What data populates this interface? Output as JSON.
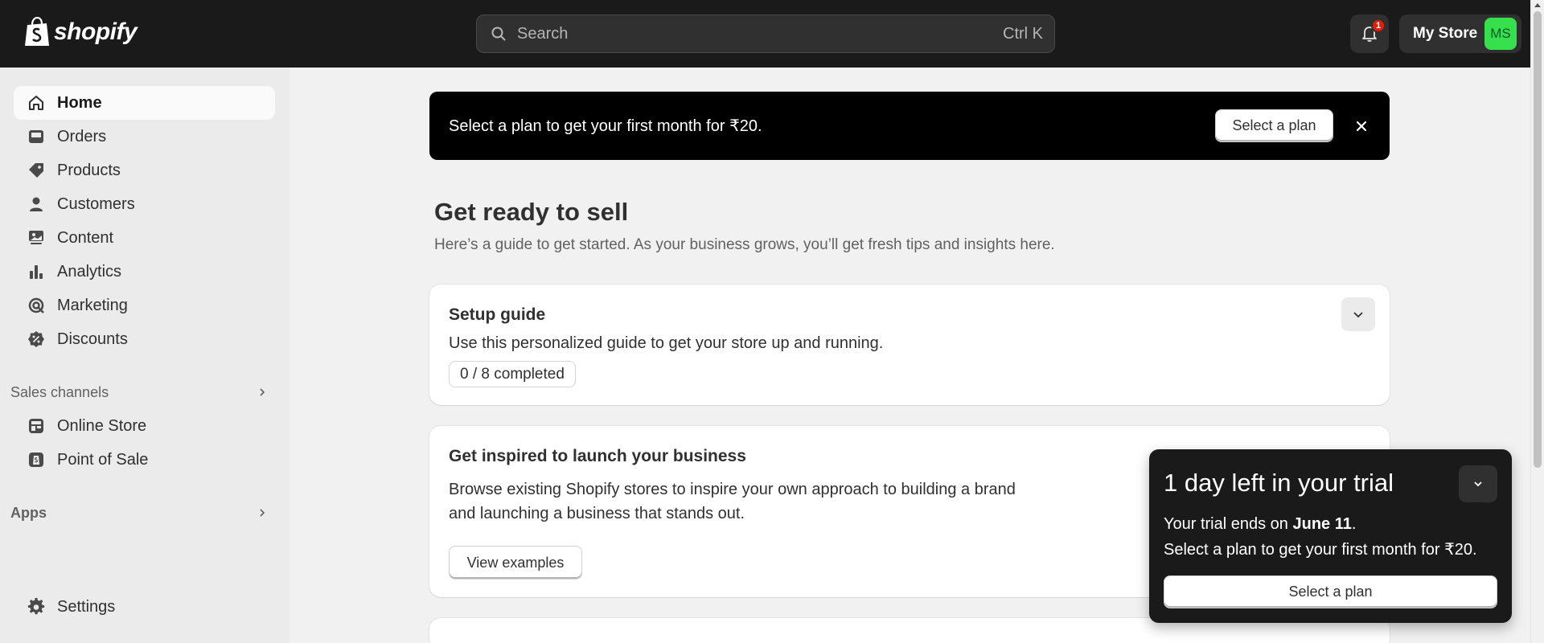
{
  "topbar": {
    "logo_text": "shopify",
    "search_placeholder": "Search",
    "search_shortcut": "Ctrl K",
    "notification_count": "1",
    "store_name": "My Store",
    "avatar_initials": "MS"
  },
  "sidebar": {
    "items": [
      {
        "label": "Home",
        "icon": "home-icon",
        "active": true
      },
      {
        "label": "Orders",
        "icon": "inbox-icon"
      },
      {
        "label": "Products",
        "icon": "tag-icon"
      },
      {
        "label": "Customers",
        "icon": "person-icon"
      },
      {
        "label": "Content",
        "icon": "content-icon"
      },
      {
        "label": "Analytics",
        "icon": "bar-chart-icon"
      },
      {
        "label": "Marketing",
        "icon": "target-icon"
      },
      {
        "label": "Discounts",
        "icon": "discount-icon"
      }
    ],
    "sales_channels_label": "Sales channels",
    "channels": [
      {
        "label": "Online Store",
        "icon": "store-icon"
      },
      {
        "label": "Point of Sale",
        "icon": "pos-icon"
      }
    ],
    "apps_label": "Apps",
    "settings_label": "Settings"
  },
  "banner": {
    "text": "Select a plan to get your first month for ₹20.",
    "button": "Select a plan"
  },
  "main": {
    "title": "Get ready to sell",
    "subtitle": "Here’s a guide to get started. As your business grows, you’ll get fresh tips and insights here.",
    "setup_card": {
      "title": "Setup guide",
      "text": "Use this personalized guide to get your store up and running.",
      "progress": "0 / 8 completed"
    },
    "inspire_card": {
      "title": "Get inspired to launch your business",
      "text_line1": "Browse existing Shopify stores to inspire your own approach to building a brand",
      "text_line2": "and launching a business that stands out.",
      "button": "View examples"
    }
  },
  "trial": {
    "title": "1 day left in your trial",
    "line1_prefix": "Your trial ends on ",
    "line1_date": "June 11",
    "line1_suffix": ".",
    "line2": "Select a plan to get your first month for ₹20.",
    "button": "Select a plan"
  },
  "colors": {
    "topbar": "#1a1a1a",
    "avatar": "#36e04c",
    "badge": "#e51c00"
  }
}
